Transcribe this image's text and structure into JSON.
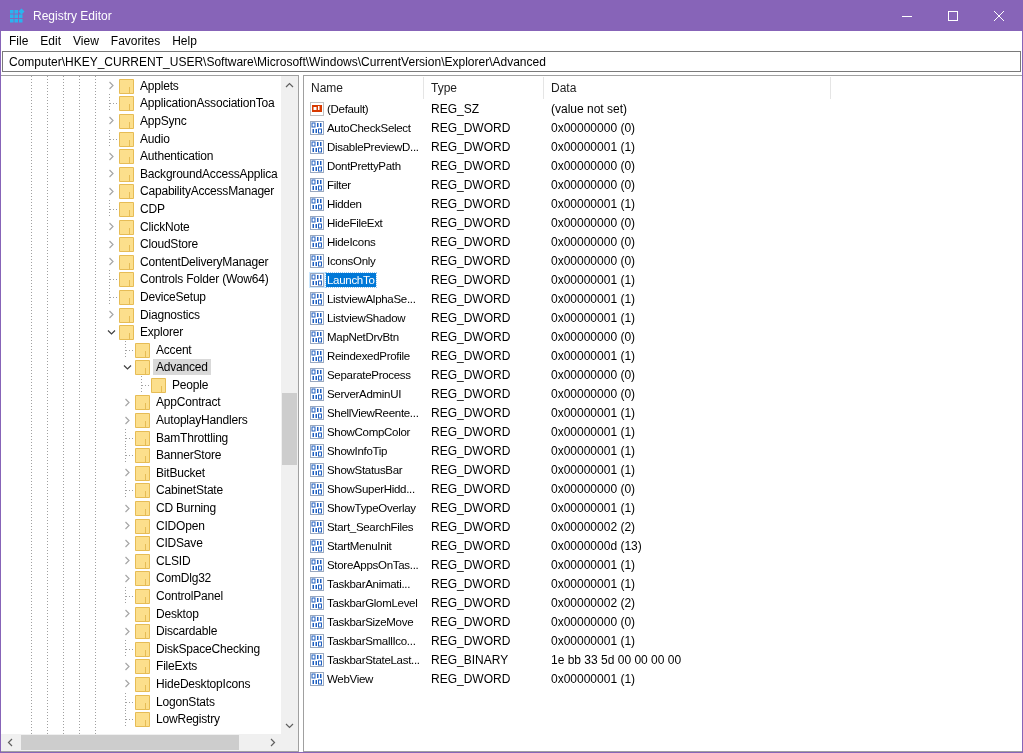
{
  "window": {
    "title": "Registry Editor"
  },
  "menu": [
    "File",
    "Edit",
    "View",
    "Favorites",
    "Help"
  ],
  "address": "Computer\\HKEY_CURRENT_USER\\Software\\Microsoft\\Windows\\CurrentVersion\\Explorer\\Advanced",
  "tree": [
    {
      "name": "Applets",
      "kind": "collapsed",
      "selected": false
    },
    {
      "name": "ApplicationAssociationToa",
      "kind": "leaf",
      "selected": false
    },
    {
      "name": "AppSync",
      "kind": "collapsed",
      "selected": false
    },
    {
      "name": "Audio",
      "kind": "leaf",
      "selected": false
    },
    {
      "name": "Authentication",
      "kind": "collapsed",
      "selected": false
    },
    {
      "name": "BackgroundAccessApplica",
      "kind": "collapsed",
      "selected": false
    },
    {
      "name": "CapabilityAccessManager",
      "kind": "collapsed",
      "selected": false
    },
    {
      "name": "CDP",
      "kind": "leaf",
      "selected": false
    },
    {
      "name": "ClickNote",
      "kind": "collapsed",
      "selected": false
    },
    {
      "name": "CloudStore",
      "kind": "collapsed",
      "selected": false
    },
    {
      "name": "ContentDeliveryManager",
      "kind": "collapsed",
      "selected": false
    },
    {
      "name": "Controls Folder (Wow64)",
      "kind": "leaf",
      "selected": false
    },
    {
      "name": "DeviceSetup",
      "kind": "leaf",
      "selected": false
    },
    {
      "name": "Diagnostics",
      "kind": "collapsed",
      "selected": false
    },
    {
      "name": "Explorer",
      "kind": "expanded",
      "selected": false,
      "children": [
        {
          "name": "Accent",
          "kind": "leaf",
          "selected": false
        },
        {
          "name": "Advanced",
          "kind": "expanded",
          "selected": true,
          "children": [
            {
              "name": "People",
              "kind": "leaf",
              "selected": false
            }
          ]
        },
        {
          "name": "AppContract",
          "kind": "collapsed",
          "selected": false
        },
        {
          "name": "AutoplayHandlers",
          "kind": "collapsed",
          "selected": false
        },
        {
          "name": "BamThrottling",
          "kind": "leaf",
          "selected": false
        },
        {
          "name": "BannerStore",
          "kind": "leaf",
          "selected": false
        },
        {
          "name": "BitBucket",
          "kind": "collapsed",
          "selected": false
        },
        {
          "name": "CabinetState",
          "kind": "leaf",
          "selected": false
        },
        {
          "name": "CD Burning",
          "kind": "collapsed",
          "selected": false
        },
        {
          "name": "CIDOpen",
          "kind": "collapsed",
          "selected": false
        },
        {
          "name": "CIDSave",
          "kind": "collapsed",
          "selected": false
        },
        {
          "name": "CLSID",
          "kind": "collapsed",
          "selected": false
        },
        {
          "name": "ComDlg32",
          "kind": "collapsed",
          "selected": false
        },
        {
          "name": "ControlPanel",
          "kind": "leaf",
          "selected": false
        },
        {
          "name": "Desktop",
          "kind": "collapsed",
          "selected": false
        },
        {
          "name": "Discardable",
          "kind": "collapsed",
          "selected": false
        },
        {
          "name": "DiskSpaceChecking",
          "kind": "leaf",
          "selected": false
        },
        {
          "name": "FileExts",
          "kind": "collapsed",
          "selected": false
        },
        {
          "name": "HideDesktopIcons",
          "kind": "collapsed",
          "selected": false
        },
        {
          "name": "LogonStats",
          "kind": "leaf",
          "selected": false
        },
        {
          "name": "LowRegistry",
          "kind": "leaf",
          "selected": false
        }
      ]
    }
  ],
  "columns": [
    "Name",
    "Type",
    "Data"
  ],
  "values": [
    {
      "name": "(Default)",
      "type": "REG_SZ",
      "data": "(value not set)",
      "kind": "text",
      "selected": false
    },
    {
      "name": "AutoCheckSelect",
      "type": "REG_DWORD",
      "data": "0x00000000 (0)",
      "kind": "binary",
      "selected": false
    },
    {
      "name": "DisablePreviewD...",
      "type": "REG_DWORD",
      "data": "0x00000001 (1)",
      "kind": "binary",
      "selected": false
    },
    {
      "name": "DontPrettyPath",
      "type": "REG_DWORD",
      "data": "0x00000000 (0)",
      "kind": "binary",
      "selected": false
    },
    {
      "name": "Filter",
      "type": "REG_DWORD",
      "data": "0x00000000 (0)",
      "kind": "binary",
      "selected": false
    },
    {
      "name": "Hidden",
      "type": "REG_DWORD",
      "data": "0x00000001 (1)",
      "kind": "binary",
      "selected": false
    },
    {
      "name": "HideFileExt",
      "type": "REG_DWORD",
      "data": "0x00000000 (0)",
      "kind": "binary",
      "selected": false
    },
    {
      "name": "HideIcons",
      "type": "REG_DWORD",
      "data": "0x00000000 (0)",
      "kind": "binary",
      "selected": false
    },
    {
      "name": "IconsOnly",
      "type": "REG_DWORD",
      "data": "0x00000000 (0)",
      "kind": "binary",
      "selected": false
    },
    {
      "name": "LaunchTo",
      "type": "REG_DWORD",
      "data": "0x00000001 (1)",
      "kind": "binary",
      "selected": true
    },
    {
      "name": "ListviewAlphaSe...",
      "type": "REG_DWORD",
      "data": "0x00000001 (1)",
      "kind": "binary",
      "selected": false
    },
    {
      "name": "ListviewShadow",
      "type": "REG_DWORD",
      "data": "0x00000001 (1)",
      "kind": "binary",
      "selected": false
    },
    {
      "name": "MapNetDrvBtn",
      "type": "REG_DWORD",
      "data": "0x00000000 (0)",
      "kind": "binary",
      "selected": false
    },
    {
      "name": "ReindexedProfile",
      "type": "REG_DWORD",
      "data": "0x00000001 (1)",
      "kind": "binary",
      "selected": false
    },
    {
      "name": "SeparateProcess",
      "type": "REG_DWORD",
      "data": "0x00000000 (0)",
      "kind": "binary",
      "selected": false
    },
    {
      "name": "ServerAdminUI",
      "type": "REG_DWORD",
      "data": "0x00000000 (0)",
      "kind": "binary",
      "selected": false
    },
    {
      "name": "ShellViewReente...",
      "type": "REG_DWORD",
      "data": "0x00000001 (1)",
      "kind": "binary",
      "selected": false
    },
    {
      "name": "ShowCompColor",
      "type": "REG_DWORD",
      "data": "0x00000001 (1)",
      "kind": "binary",
      "selected": false
    },
    {
      "name": "ShowInfoTip",
      "type": "REG_DWORD",
      "data": "0x00000001 (1)",
      "kind": "binary",
      "selected": false
    },
    {
      "name": "ShowStatusBar",
      "type": "REG_DWORD",
      "data": "0x00000001 (1)",
      "kind": "binary",
      "selected": false
    },
    {
      "name": "ShowSuperHidd...",
      "type": "REG_DWORD",
      "data": "0x00000000 (0)",
      "kind": "binary",
      "selected": false
    },
    {
      "name": "ShowTypeOverlay",
      "type": "REG_DWORD",
      "data": "0x00000001 (1)",
      "kind": "binary",
      "selected": false
    },
    {
      "name": "Start_SearchFiles",
      "type": "REG_DWORD",
      "data": "0x00000002 (2)",
      "kind": "binary",
      "selected": false
    },
    {
      "name": "StartMenuInit",
      "type": "REG_DWORD",
      "data": "0x0000000d (13)",
      "kind": "binary",
      "selected": false
    },
    {
      "name": "StoreAppsOnTas...",
      "type": "REG_DWORD",
      "data": "0x00000001 (1)",
      "kind": "binary",
      "selected": false
    },
    {
      "name": "TaskbarAnimati...",
      "type": "REG_DWORD",
      "data": "0x00000001 (1)",
      "kind": "binary",
      "selected": false
    },
    {
      "name": "TaskbarGlomLevel",
      "type": "REG_DWORD",
      "data": "0x00000002 (2)",
      "kind": "binary",
      "selected": false
    },
    {
      "name": "TaskbarSizeMove",
      "type": "REG_DWORD",
      "data": "0x00000000 (0)",
      "kind": "binary",
      "selected": false
    },
    {
      "name": "TaskbarSmallIco...",
      "type": "REG_DWORD",
      "data": "0x00000001 (1)",
      "kind": "binary",
      "selected": false
    },
    {
      "name": "TaskbarStateLast...",
      "type": "REG_BINARY",
      "data": "1e bb 33 5d 00 00 00 00",
      "kind": "binary",
      "selected": false
    },
    {
      "name": "WebView",
      "type": "REG_DWORD",
      "data": "0x00000001 (1)",
      "kind": "binary",
      "selected": false
    }
  ]
}
